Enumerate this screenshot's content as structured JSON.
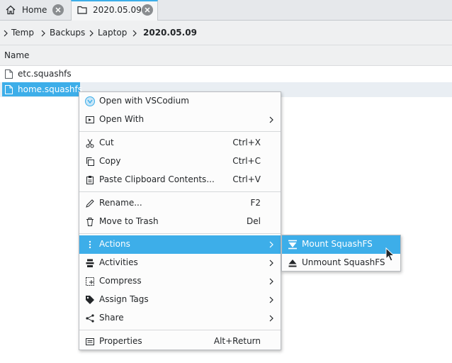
{
  "tabs": [
    {
      "label": "Home",
      "icon": "home-icon",
      "active": false
    },
    {
      "label": "2020.05.09",
      "icon": "folder-icon",
      "active": true
    }
  ],
  "breadcrumb": [
    "Temp",
    "Backups",
    "Laptop",
    "2020.05.09"
  ],
  "columns": {
    "name": "Name"
  },
  "files": [
    {
      "name": "etc.squashfs",
      "selected": false
    },
    {
      "name": "home.squashfs",
      "selected": true
    }
  ],
  "menu": {
    "open_with_vscodium": "Open with VSCodium",
    "open_with": "Open With",
    "cut": "Cut",
    "cut_sc": "Ctrl+X",
    "copy": "Copy",
    "copy_sc": "Ctrl+C",
    "paste": "Paste Clipboard Contents...",
    "paste_sc": "Ctrl+V",
    "rename": "Rename...",
    "rename_sc": "F2",
    "trash": "Move to Trash",
    "trash_sc": "Del",
    "actions": "Actions",
    "activities": "Activities",
    "compress": "Compress",
    "assign_tags": "Assign Tags",
    "share": "Share",
    "properties": "Properties",
    "properties_sc": "Alt+Return"
  },
  "submenu": {
    "mount": "Mount SquashFS",
    "unmount": "Unmount SquashFS"
  },
  "colors": {
    "accent": "#3daee9",
    "text": "#232629",
    "background": "#ffffff"
  }
}
